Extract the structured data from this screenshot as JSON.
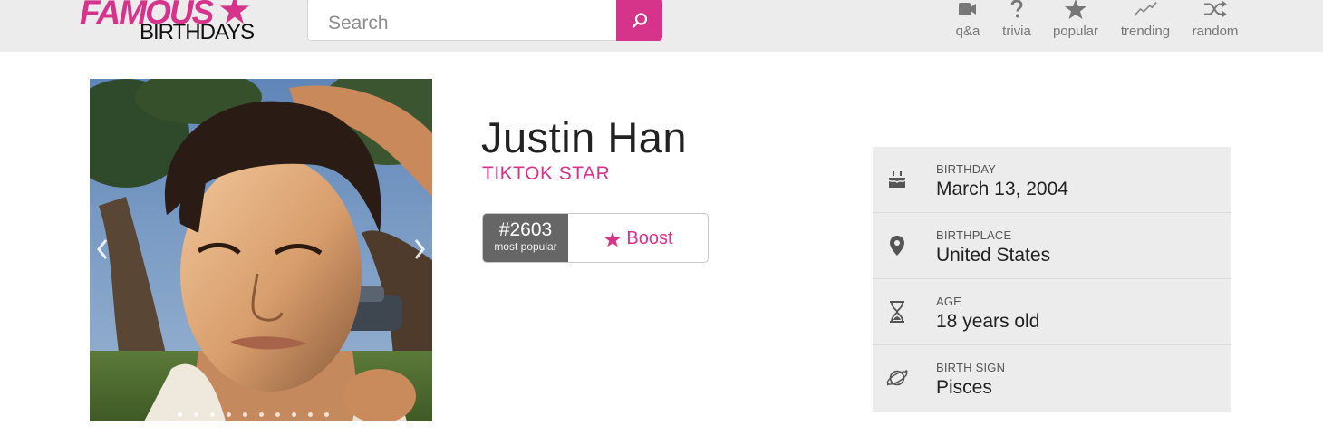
{
  "brand": {
    "logo_top": "FAMOUS",
    "logo_bottom": "BIRTHDAYS",
    "accent_color": "#d6338a"
  },
  "search": {
    "placeholder": "Search",
    "button_icon": "search-icon"
  },
  "nav": {
    "items": [
      {
        "label": "q&a",
        "icon": "video-camera-icon"
      },
      {
        "label": "trivia",
        "icon": "question-mark-icon"
      },
      {
        "label": "popular",
        "icon": "star-icon"
      },
      {
        "label": "trending",
        "icon": "trending-line-icon"
      },
      {
        "label": "random",
        "icon": "shuffle-icon"
      }
    ]
  },
  "profile": {
    "name": "Justin Han",
    "profession": "TIKTOK STAR",
    "rank": "#2603",
    "rank_caption": "most popular",
    "boost_label": "Boost"
  },
  "photo": {
    "slide_count": 10,
    "active_slide": 1
  },
  "info": {
    "rows": [
      {
        "label": "BIRTHDAY",
        "value": "March 13, 2004",
        "icon": "cake-icon"
      },
      {
        "label": "BIRTHPLACE",
        "value": "United States",
        "icon": "map-pin-icon"
      },
      {
        "label": "AGE",
        "value": "18 years old",
        "icon": "hourglass-icon"
      },
      {
        "label": "BIRTH SIGN",
        "value": "Pisces",
        "icon": "planet-icon"
      }
    ]
  }
}
